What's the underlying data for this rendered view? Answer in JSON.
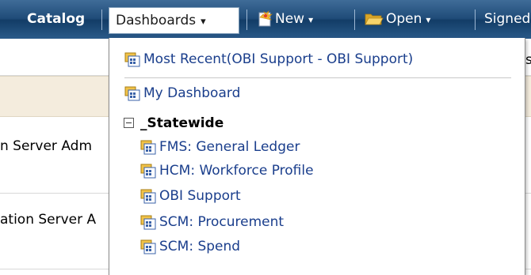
{
  "header": {
    "catalog_label": "Catalog",
    "dashboards_label": "Dashboards",
    "new_label": "New",
    "open_label": "Open",
    "signed_label": "Signed"
  },
  "background": {
    "row1_text": "n Server Adm",
    "row2_text": "ation Server A",
    "partial_char": "s"
  },
  "menu": {
    "most_recent": "Most Recent(OBI Support - OBI Support)",
    "my_dashboard": "My Dashboard",
    "group_label": "_Statewide",
    "group_items": [
      "FMS: General Ledger",
      "HCM: Workforce Profile",
      "OBI Support",
      "SCM: Procurement",
      "SCM: Spend"
    ]
  },
  "colors": {
    "header_bg": "#1f4b78",
    "menu_link": "#1a3e8c",
    "band_bg": "#f4ecdd"
  },
  "icons": {
    "dashboard": "dashboard-icon",
    "new": "new-document-icon",
    "open": "open-folder-icon",
    "expand": "collapse-toggle-icon"
  }
}
